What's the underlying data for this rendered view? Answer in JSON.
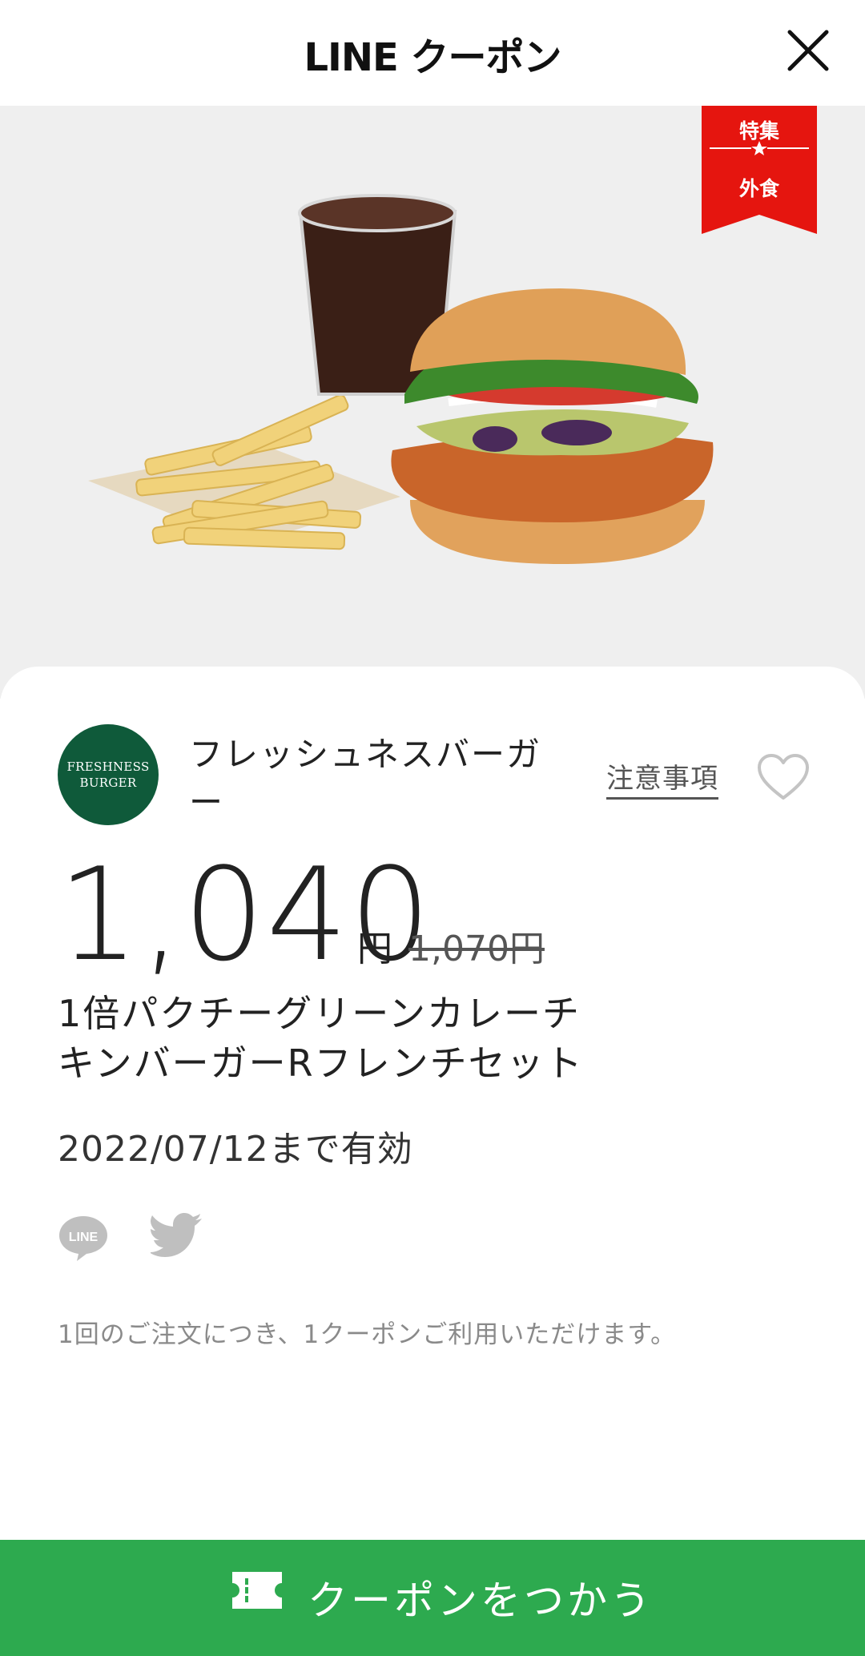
{
  "header": {
    "title": "LINE クーポン",
    "close_icon": "close-icon"
  },
  "hero": {
    "ribbon": {
      "top_label": "特集",
      "bottom_label": "外食",
      "color": "#e5150f"
    }
  },
  "store": {
    "logo_line1": "FRESHNESS",
    "logo_line2": "BURGER",
    "name": "フレッシュネスバーガー",
    "logo_color": "#0f5a3a"
  },
  "actions": {
    "notice_label": "注意事項",
    "favorite_icon": "heart-outline-icon"
  },
  "price": {
    "current": "1,040",
    "unit": "円",
    "original": "1,070円"
  },
  "product": {
    "name": "1倍パクチーグリーンカレーチキンバーガーRフレンチセット"
  },
  "validity": "2022/07/12まで有効",
  "share": {
    "line_icon": "line-share-icon",
    "line_label": "LINE",
    "twitter_icon": "twitter-share-icon"
  },
  "note": "1回のご注文につき、1クーポンご利用いただけます。",
  "cta": {
    "label": "クーポンをつかう",
    "icon": "ticket-icon",
    "color": "#2daa4f"
  }
}
